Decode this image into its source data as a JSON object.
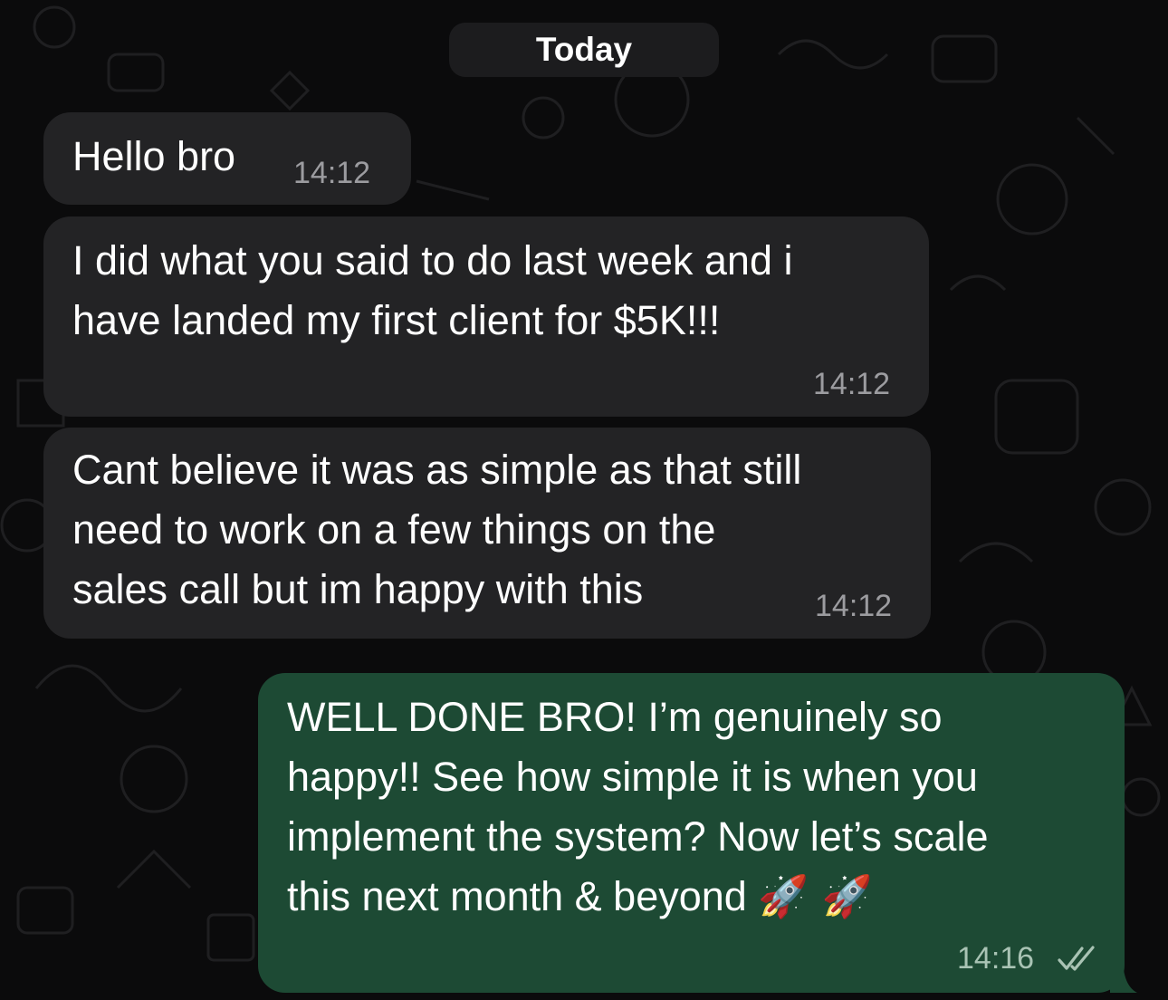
{
  "date_separator": "Today",
  "messages": [
    {
      "direction": "incoming",
      "lines": [
        "Hello bro"
      ],
      "time": "14:12"
    },
    {
      "direction": "incoming",
      "lines": [
        "I did what you said to do last week and i",
        "have landed my first client for $5K!!!"
      ],
      "time": "14:12"
    },
    {
      "direction": "incoming",
      "lines": [
        "Cant believe it was as simple as that still",
        "need to work on a few things on the",
        "sales call but im happy with this"
      ],
      "time": "14:12"
    },
    {
      "direction": "outgoing",
      "lines": [
        "WELL DONE BRO! I’m genuinely so",
        "happy!! See how simple it is when you",
        "implement the system? Now let’s scale",
        "this next month & beyond"
      ],
      "emoji": "🚀 🚀",
      "time": "14:16",
      "status_icon": "double-check-icon"
    }
  ],
  "colors": {
    "background": "#0b0b0c",
    "incoming_bubble": "#232325",
    "outgoing_bubble": "#1d4a34",
    "timestamp": "#9c9ca0"
  }
}
